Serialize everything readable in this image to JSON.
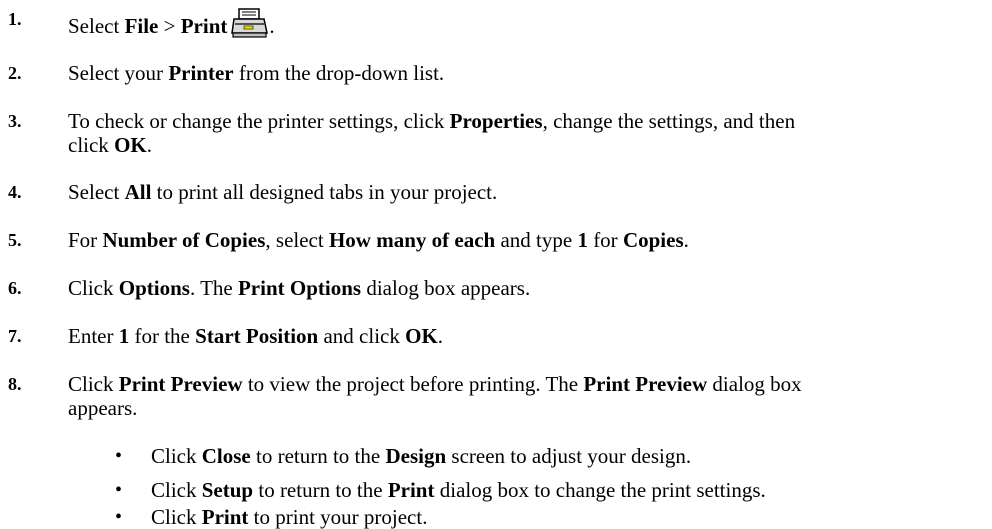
{
  "steps": [
    {
      "num": "1.",
      "parts": [
        {
          "t": "Select ",
          "b": false
        },
        {
          "t": "File",
          "b": true
        },
        {
          "t": " > ",
          "b": false
        },
        {
          "t": "Print",
          "b": true
        }
      ],
      "icon": "printer-icon",
      "after_icon": "."
    },
    {
      "num": "2.",
      "parts": [
        {
          "t": "Select your ",
          "b": false
        },
        {
          "t": "Printer",
          "b": true
        },
        {
          "t": " from the drop-down list.",
          "b": false
        }
      ]
    },
    {
      "num": "3.",
      "parts": [
        {
          "t": "To check or change the printer settings, click ",
          "b": false
        },
        {
          "t": "Properties",
          "b": true
        },
        {
          "t": ", change the settings, and then",
          "b": false
        }
      ],
      "line2": [
        {
          "t": "click ",
          "b": false
        },
        {
          "t": "OK",
          "b": true
        },
        {
          "t": ".",
          "b": false
        }
      ]
    },
    {
      "num": "4.",
      "parts": [
        {
          "t": "Select ",
          "b": false
        },
        {
          "t": "All",
          "b": true
        },
        {
          "t": " to print all designed tabs in your project.",
          "b": false
        }
      ]
    },
    {
      "num": "5.",
      "parts": [
        {
          "t": "For ",
          "b": false
        },
        {
          "t": "Number of Copies",
          "b": true
        },
        {
          "t": ", select ",
          "b": false
        },
        {
          "t": "How many of each",
          "b": true
        },
        {
          "t": " and type ",
          "b": false
        },
        {
          "t": "1",
          "b": true
        },
        {
          "t": " for ",
          "b": false
        },
        {
          "t": "Copies",
          "b": true
        },
        {
          "t": ".",
          "b": false
        }
      ]
    },
    {
      "num": "6.",
      "parts": [
        {
          "t": "Click ",
          "b": false
        },
        {
          "t": "Options",
          "b": true
        },
        {
          "t": ". The ",
          "b": false
        },
        {
          "t": "Print Options",
          "b": true
        },
        {
          "t": " dialog box appears.",
          "b": false
        }
      ]
    },
    {
      "num": "7.",
      "parts": [
        {
          "t": "Enter ",
          "b": false
        },
        {
          "t": "1",
          "b": true
        },
        {
          "t": " for the ",
          "b": false
        },
        {
          "t": "Start Position",
          "b": true
        },
        {
          "t": " and click ",
          "b": false
        },
        {
          "t": "OK",
          "b": true
        },
        {
          "t": ".",
          "b": false
        }
      ]
    },
    {
      "num": "8.",
      "parts": [
        {
          "t": "Click ",
          "b": false
        },
        {
          "t": "Print Preview",
          "b": true
        },
        {
          "t": " to view the project before printing. The ",
          "b": false
        },
        {
          "t": "Print Preview",
          "b": true
        },
        {
          "t": " dialog box",
          "b": false
        }
      ],
      "line2": [
        {
          "t": "appears.",
          "b": false
        }
      ]
    }
  ],
  "bullets": [
    {
      "marker": "•",
      "parts": [
        {
          "t": "Click ",
          "b": false
        },
        {
          "t": "Close",
          "b": true
        },
        {
          "t": " to return to the ",
          "b": false
        },
        {
          "t": "Design",
          "b": true
        },
        {
          "t": " screen to adjust your design.",
          "b": false
        }
      ]
    },
    {
      "marker": "•",
      "parts": [
        {
          "t": "Click ",
          "b": false
        },
        {
          "t": "Setup",
          "b": true
        },
        {
          "t": " to return to the ",
          "b": false
        },
        {
          "t": "Print",
          "b": true
        },
        {
          "t": " dialog box to change the print settings.",
          "b": false
        }
      ]
    },
    {
      "marker": "•",
      "parts": [
        {
          "t": "Click ",
          "b": false
        },
        {
          "t": "Print",
          "b": true
        },
        {
          "t": " to print your project.",
          "b": false
        }
      ]
    }
  ],
  "colors": {
    "text": "#000000",
    "printer_highlight": "#f2e200"
  }
}
